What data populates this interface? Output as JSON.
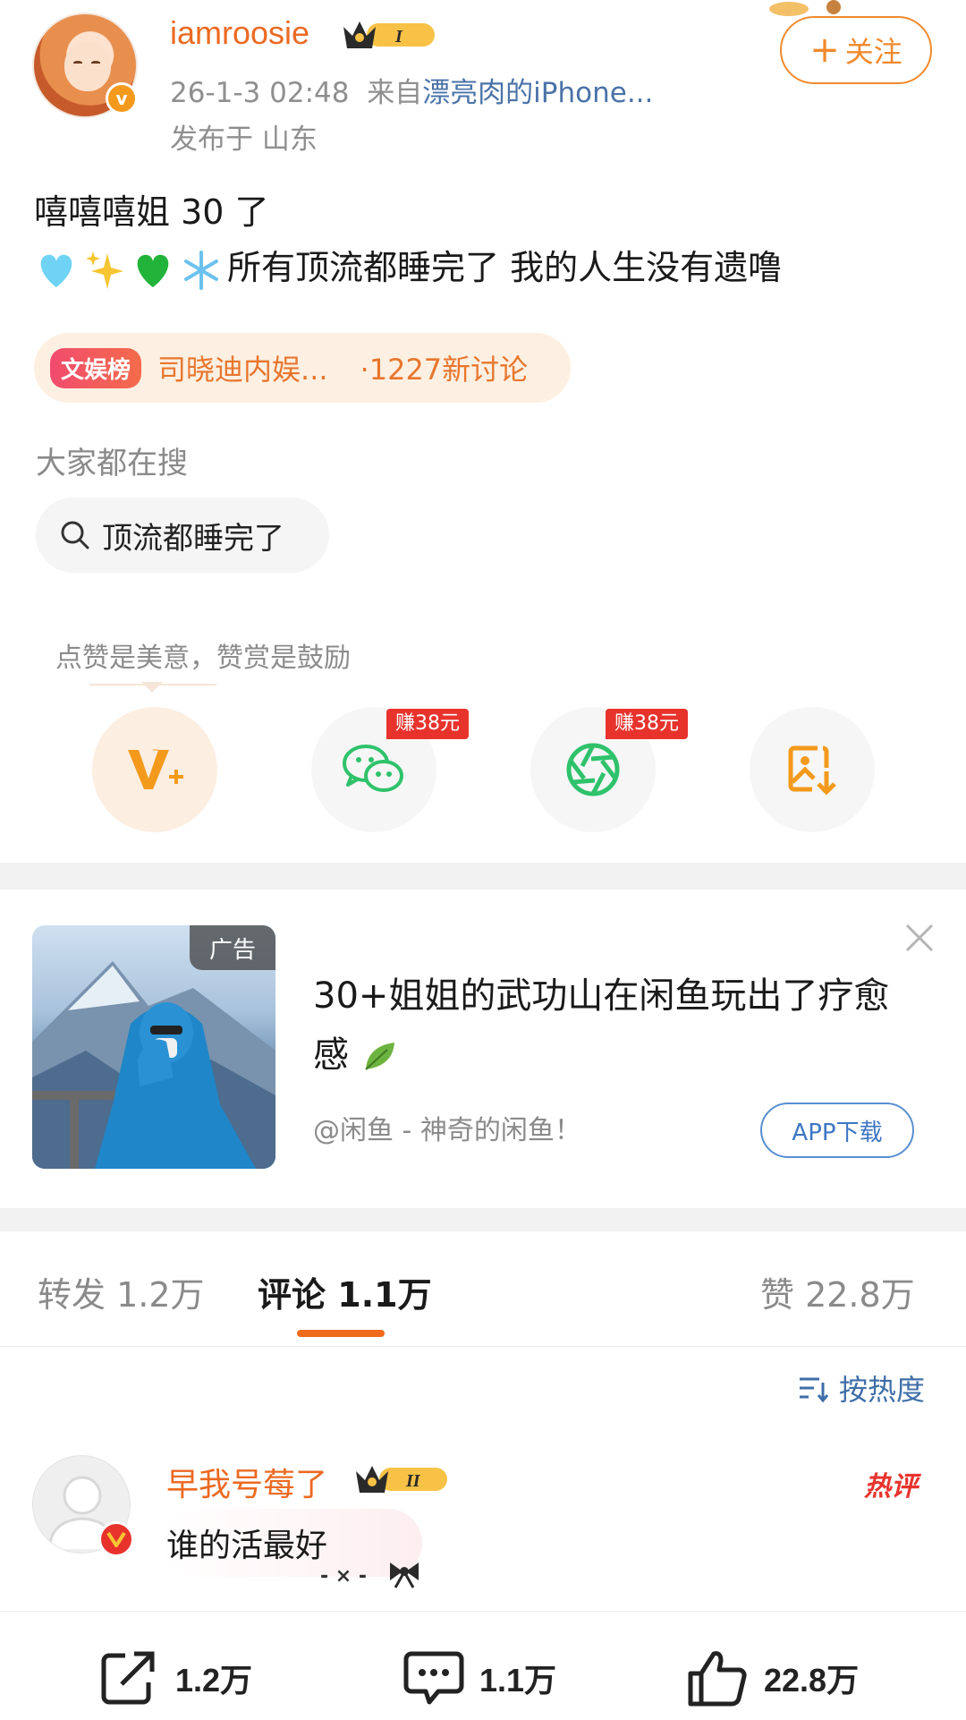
{
  "header": {
    "username": "iamroosie",
    "vip_level": "I",
    "timestamp": "26-1-3 02:48",
    "source_prefix": "来自",
    "source_device": "漂亮肉的iPhone...",
    "location": "发布于 山东",
    "follow_label": "关注",
    "follow_plus": "+"
  },
  "post": {
    "line1": "嘻嘻嘻姐 30 了",
    "line2_text": "所有顶流都睡完了 我的人生没有遗噜",
    "emojis": [
      "light-blue-heart",
      "sparkles",
      "green-heart",
      "snowflake"
    ]
  },
  "hot_list": {
    "tag": "文娱榜",
    "title": "司晓迪内娱...",
    "count": "·1227新讨论"
  },
  "search": {
    "label": "大家都在搜",
    "query": "顶流都睡完了"
  },
  "reward": {
    "hint": "点赞是美意，赞赏是鼓励",
    "earn_wechat": "赚38元",
    "earn_moments": "赚38元"
  },
  "ad": {
    "badge": "广告",
    "title": "30+姐姐的武功山在闲鱼玩出了疗愈感",
    "source": "@闲鱼 - 神奇的闲鱼！",
    "download_label": "APP下载"
  },
  "tabs": {
    "repost": "转发 1.2万",
    "comment_label": "评论",
    "comment_count": "1.1万",
    "like": "赞 22.8万"
  },
  "sort": {
    "label": "按热度"
  },
  "comment": {
    "username": "早我号莓了",
    "vip_level": "II",
    "text": "谁的活最好",
    "hot_badge": "热评",
    "deco_text": "- × -"
  },
  "bottom_bar": {
    "repost": "1.2万",
    "comment": "1.1万",
    "like": "22.8万"
  },
  "colors": {
    "accent_orange": "#eb6a22",
    "link_blue": "#4a73a8",
    "earn_red": "#e8332d",
    "wechat_green": "#2fc26b"
  }
}
